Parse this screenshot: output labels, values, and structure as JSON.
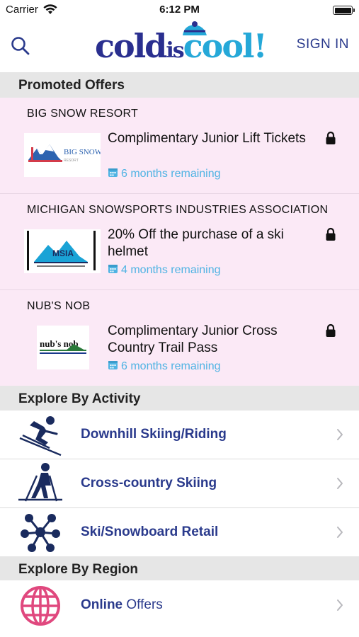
{
  "status_bar": {
    "carrier": "Carrier",
    "time": "6:12 PM"
  },
  "nav": {
    "sign_in_label": "SIGN IN",
    "search_icon": "search-icon",
    "logo_text": {
      "cold": "cold",
      "is": "is",
      "cool": "cool!"
    }
  },
  "promoted": {
    "header": "Promoted Offers",
    "offers": [
      {
        "org": "BIG SNOW RESORT",
        "title": "Complimentary Junior Lift Tickets",
        "remaining": "6 months remaining",
        "logo_text": "BIG SNOW RESORT"
      },
      {
        "org": "MICHIGAN SNOWSPORTS INDUSTRIES ASSOCIATION",
        "title": "20% Off the purchase of a ski helmet",
        "remaining": "4 months remaining",
        "logo_text": "MSIA"
      },
      {
        "org": "NUB'S NOB",
        "title": "Complimentary Junior Cross Country Trail Pass",
        "remaining": "6 months remaining",
        "logo_text": "nub's nob"
      }
    ]
  },
  "activity": {
    "header": "Explore By Activity",
    "items": [
      {
        "label": "Downhill Skiing/Riding",
        "icon": "downhill-skier-icon"
      },
      {
        "label": "Cross-country Skiing",
        "icon": "cross-country-skier-icon"
      },
      {
        "label": "Ski/Snowboard Retail",
        "icon": "retail-network-icon"
      }
    ]
  },
  "region": {
    "header": "Explore By Region",
    "items": [
      {
        "label_bold": "Online",
        "label_light": " Offers",
        "icon": "globe-icon"
      }
    ]
  },
  "colors": {
    "brand_navy": "#2a3a8c",
    "accent_blue": "#4fb3e3",
    "offer_bg": "#fbe9f6",
    "section_bg": "#e6e6e6",
    "globe_pink": "#e0487e"
  }
}
